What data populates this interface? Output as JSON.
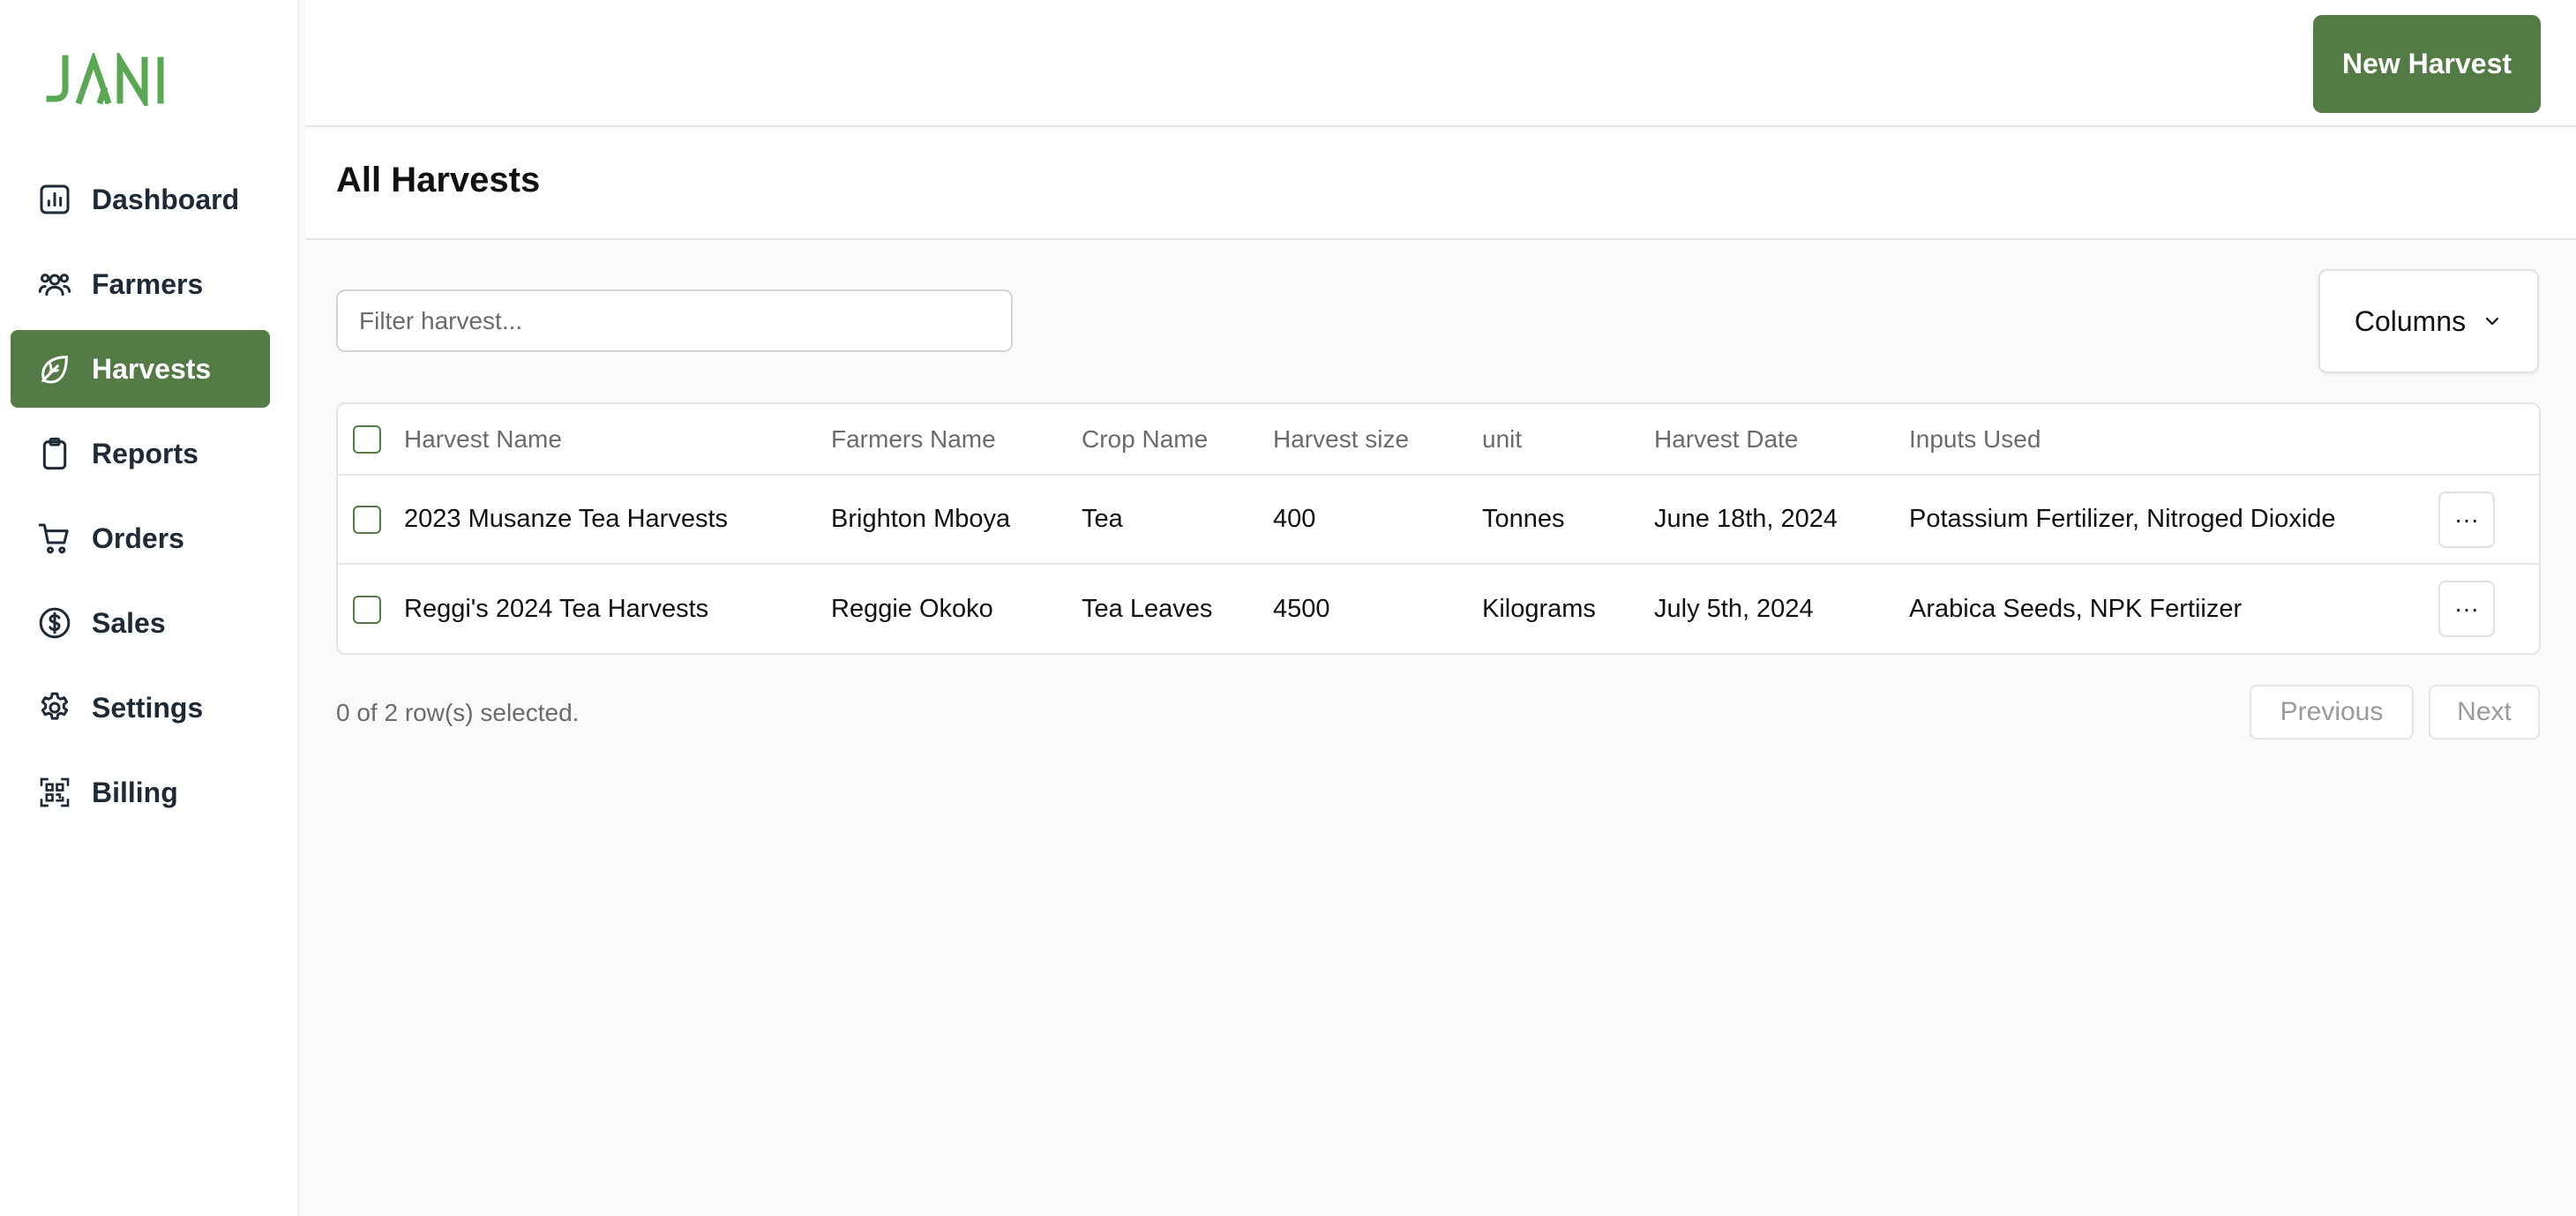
{
  "brand": {
    "logo_text": "JANI",
    "accent_color": "#547a46",
    "logo_color": "#5aa853"
  },
  "sidebar": {
    "items": [
      {
        "label": "Dashboard",
        "icon": "chart-icon",
        "active": false
      },
      {
        "label": "Farmers",
        "icon": "users-icon",
        "active": false
      },
      {
        "label": "Harvests",
        "icon": "leaf-icon",
        "active": true
      },
      {
        "label": "Reports",
        "icon": "clipboard-icon",
        "active": false
      },
      {
        "label": "Orders",
        "icon": "cart-icon",
        "active": false
      },
      {
        "label": "Sales",
        "icon": "dollar-icon",
        "active": false
      },
      {
        "label": "Settings",
        "icon": "gear-icon",
        "active": false
      },
      {
        "label": "Billing",
        "icon": "qr-icon",
        "active": false
      }
    ]
  },
  "header": {
    "new_button_label": "New Harvest"
  },
  "page": {
    "title": "All Harvests"
  },
  "toolbar": {
    "filter_placeholder": "Filter harvest...",
    "filter_value": "",
    "columns_label": "Columns"
  },
  "table": {
    "columns": [
      "Harvest Name",
      "Farmers Name",
      "Crop Name",
      "Harvest size",
      "unit",
      "Harvest Date",
      "Inputs Used"
    ],
    "rows": [
      [
        "2023 Musanze Tea Harvests",
        "Brighton Mboya",
        "Tea",
        "400",
        "Tonnes",
        "June 18th, 2024",
        "Potassium Fertilizer, Nitroged Dioxide"
      ],
      [
        "Reggi's 2024 Tea Harvests",
        "Reggie Okoko",
        "Tea Leaves",
        "4500",
        "Kilograms",
        "July 5th, 2024",
        "Arabica Seeds, NPK Fertiizer"
      ]
    ],
    "row_menu_label": "···"
  },
  "footer": {
    "selection_text": "0 of 2 row(s) selected.",
    "previous_label": "Previous",
    "next_label": "Next"
  }
}
